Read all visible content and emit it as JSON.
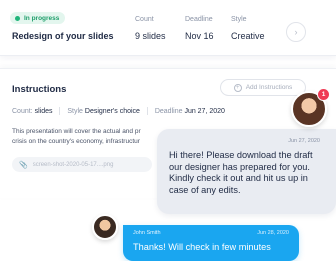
{
  "order": {
    "status": "In progress",
    "title": "Redesign of your slides",
    "count_label": "Count",
    "count_value": "9 slides",
    "deadline_label": "Deadline",
    "deadline_value": "Nov 16",
    "style_label": "Style",
    "style_value": "Creative",
    "status_color": "#1fb57a"
  },
  "instructions": {
    "title": "Instructions",
    "add_button_label": "Add Instructions",
    "count_label": "Count:",
    "count_value": "slides",
    "style_label": "Style",
    "style_value": "Designer's choice",
    "deadline_label": "Deadline",
    "deadline_value": "Jun 27, 2020",
    "description": "This presentation will cover the actual and pr… crisis on the country's economy, infrastructur…",
    "description_line1": "This presentation will cover the actual and pr",
    "description_line2": "crisis on the country's economy, infrastructur",
    "attachment": "screen-shot-2020-05-17....png"
  },
  "chat": {
    "designer_date": "Jun 27, 2020",
    "designer_message": "Hi there! Please download the draft our designer has prepared for you. Kindly check it out and hit us up in case of any edits.",
    "notification_count": "1",
    "user_name": "John Smith",
    "user_date": "Jun 28, 2020",
    "user_message": "Thanks! Will check in few minutes",
    "user_bubble_color": "#1aa6f0"
  }
}
